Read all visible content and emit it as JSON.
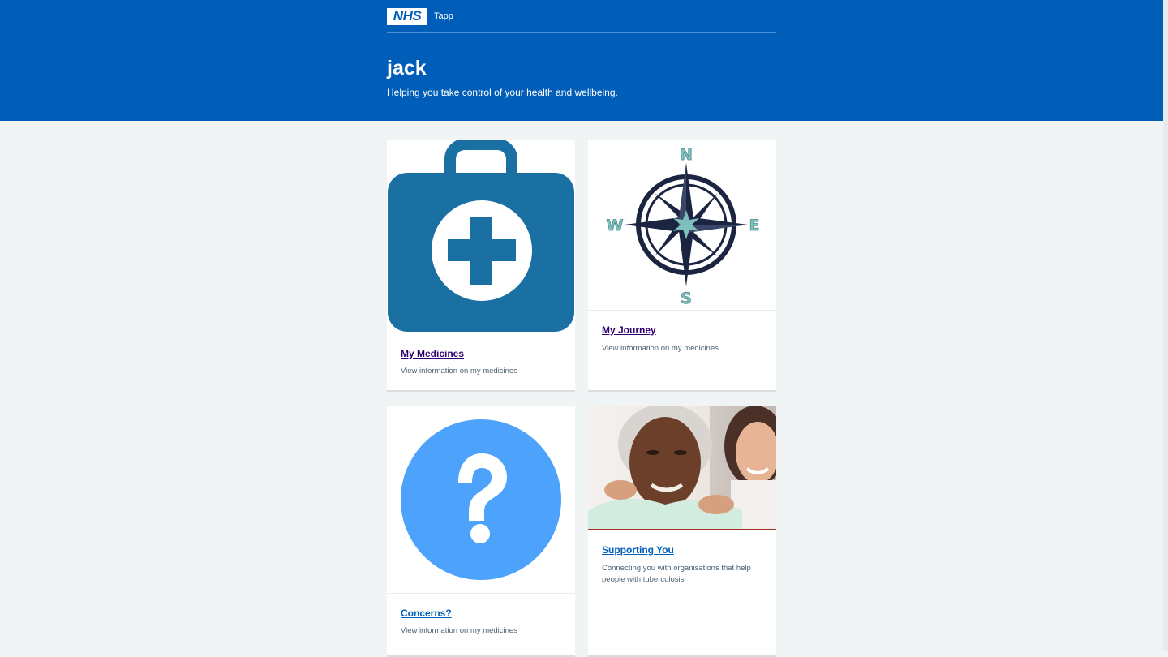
{
  "header": {
    "logo_text": "NHS",
    "service_name": "Tapp",
    "title": "jack",
    "lede": "Helping you take control of your health and wellbeing."
  },
  "cards": [
    {
      "link": "My Medicines",
      "description": "View information on my medicines",
      "image": "medical-kit-icon",
      "link_color": "#330072"
    },
    {
      "link": "My Journey",
      "description": "View information on my medicines",
      "image": "compass-icon",
      "link_color": "#330072",
      "compass_letters": {
        "n": "N",
        "e": "E",
        "s": "S",
        "w": "W"
      }
    },
    {
      "link": "Concerns?",
      "description": "View information on my medicines",
      "image": "question-mark-icon",
      "link_color": "#005eb8"
    },
    {
      "link": "Supporting You",
      "description": "Connecting you with organisations that help people with tuberculosis",
      "image": "photo-carer-and-elderly-woman",
      "link_color": "#005eb8"
    }
  ],
  "colors": {
    "header_bg": "#005eb8",
    "page_bg": "#f0f4f5",
    "kit_blue": "#1a6fa3",
    "question_blue": "#4da2fb",
    "compass_navy": "#1b2440",
    "compass_teal": "#7fbfbe"
  }
}
